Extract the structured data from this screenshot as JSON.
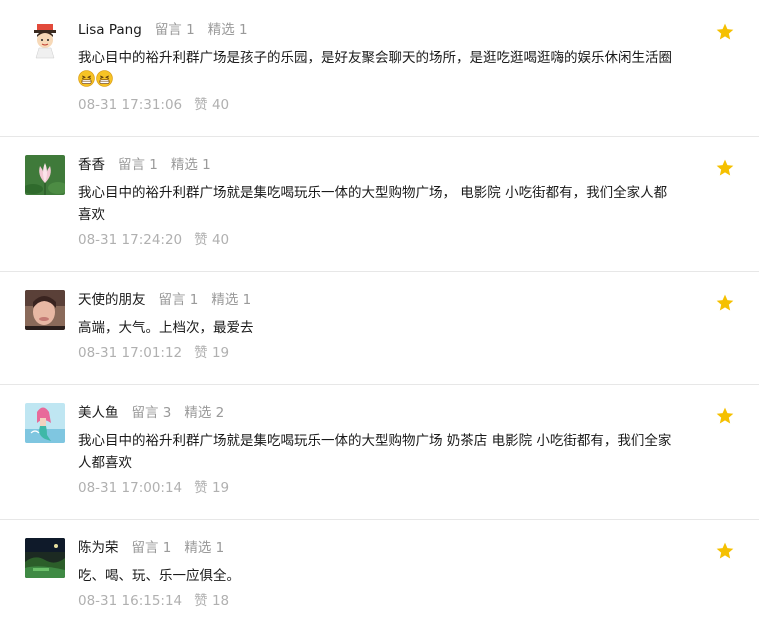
{
  "colors": {
    "star": "#f5c000",
    "meta_gray": "#9a9a9a",
    "footer_gray": "#b0b0b0",
    "divider": "#e7e7e7"
  },
  "comments": [
    {
      "name": "Lisa Pang",
      "replies": "留言 1",
      "featured": "精选 1",
      "text": "我心目中的裕升利群广场是孩子的乐园，是好友聚会聊天的场所，是逛吃逛喝逛嗨的娱乐休闲生活圈",
      "emojis": [
        "grin-emoji",
        "grin-emoji"
      ],
      "time": "08-31 17:31:06",
      "likes": "赞 40",
      "avatar_icon": "cartoon-girl-avatar"
    },
    {
      "name": "香香",
      "replies": "留言 1",
      "featured": "精选 1",
      "text": "我心目中的裕升利群广场就是集吃喝玩乐一体的大型购物广场， 电影院 小吃街都有，我们全家人都喜欢",
      "time": "08-31 17:24:20",
      "likes": "赞 40",
      "avatar_icon": "lotus-avatar"
    },
    {
      "name": "天使的朋友",
      "replies": "留言 1",
      "featured": "精选 1",
      "text": "高端，大气。上档次，最爱去",
      "time": "08-31 17:01:12",
      "likes": "赞 19",
      "avatar_icon": "portrait-photo-avatar"
    },
    {
      "name": "美人鱼",
      "replies": "留言 3",
      "featured": "精选 2",
      "text": "我心目中的裕升利群广场就是集吃喝玩乐一体的大型购物广场 奶茶店 电影院 小吃街都有，我们全家人都喜欢",
      "time": "08-31 17:00:14",
      "likes": "赞 19",
      "avatar_icon": "mermaid-avatar"
    },
    {
      "name": "陈为荣",
      "replies": "留言 1",
      "featured": "精选 1",
      "text": "吃、喝、玩、乐一应俱全。",
      "time": "08-31 16:15:14",
      "likes": "赞 18",
      "avatar_icon": "dark-scenery-avatar"
    }
  ]
}
